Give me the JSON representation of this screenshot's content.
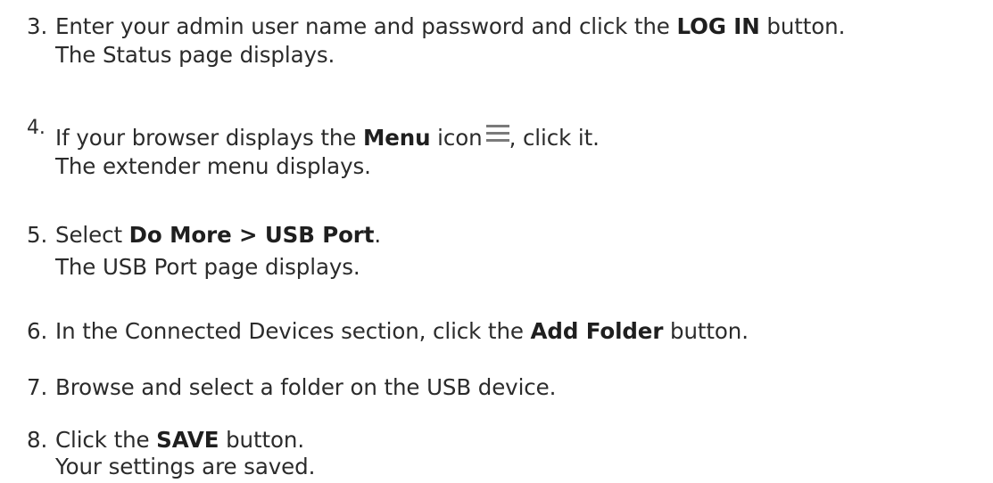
{
  "steps": [
    {
      "number": "3.",
      "line1": {
        "pre": "Enter your admin user name and password and click the ",
        "bold": "LOG IN",
        "post": " button."
      },
      "line2": "The Status page displays."
    },
    {
      "number": "4.",
      "line1": {
        "pre": "If your browser displays the ",
        "bold": "Menu",
        "mid": " icon",
        "post": ", click it."
      },
      "icon": "menu-icon",
      "line2": "The extender menu displays."
    },
    {
      "number": "5.",
      "line1": {
        "pre": "Select ",
        "bold": "Do More > USB Port",
        "post": "."
      },
      "line2": "The USB Port page displays."
    },
    {
      "number": "6.",
      "line1": {
        "pre": "In the Connected Devices section, click the ",
        "bold": "Add Folder",
        "post": " button."
      }
    },
    {
      "number": "7.",
      "line1": {
        "pre": "Browse and select a folder on the USB device."
      }
    },
    {
      "number": "8.",
      "line1": {
        "pre": "Click the ",
        "bold": "SAVE",
        "post": " button."
      },
      "line2": "Your settings are saved."
    }
  ],
  "colors": {
    "text": "#2b2b2b",
    "icon": "#7a7a7a"
  }
}
